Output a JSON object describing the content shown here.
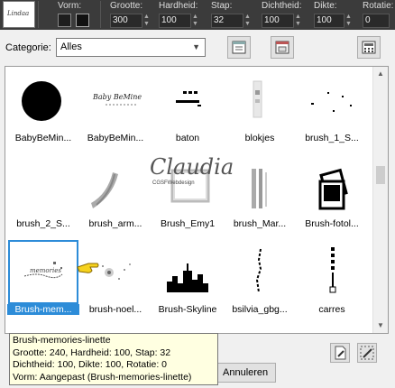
{
  "toolbar": {
    "thumb_text": "Lindaa",
    "shape_label": "Vorm:",
    "fields": [
      {
        "label": "Grootte:",
        "value": "300"
      },
      {
        "label": "Hardheid:",
        "value": "100"
      },
      {
        "label": "Stap:",
        "value": "32"
      },
      {
        "label": "Dichtheid:",
        "value": "100"
      },
      {
        "label": "Dikte:",
        "value": "100"
      },
      {
        "label": "Rotatie:",
        "value": "0"
      }
    ]
  },
  "category": {
    "label": "Categorie:",
    "value": "Alles"
  },
  "brushes": [
    {
      "name": "BabyBeMin..."
    },
    {
      "name": "BabyBeMin..."
    },
    {
      "name": "baton"
    },
    {
      "name": "blokjes"
    },
    {
      "name": "brush_1_S..."
    },
    {
      "name": "brush_2_S..."
    },
    {
      "name": "brush_arm..."
    },
    {
      "name": "Brush_Emy1"
    },
    {
      "name": "brush_Mar..."
    },
    {
      "name": "Brush-fotol..."
    },
    {
      "name": "Brush-mem..."
    },
    {
      "name": "brush-noel..."
    },
    {
      "name": "Brush-Skyline"
    },
    {
      "name": "bsilvia_gbg..."
    },
    {
      "name": "carres"
    }
  ],
  "watermark": {
    "line1": "Claudia",
    "line2": "CGSFWebdesign"
  },
  "tooltip": {
    "line1": "Brush-memories-linette",
    "line2": "Grootte: 240, Hardheid: 100, Stap: 32",
    "line3": "Dichtheid: 100, Dikte: 100, Rotatie: 0",
    "line4": "Vorm: Aangepast (Brush-memories-linette)"
  },
  "buttons": {
    "cancel": "Annuleren"
  }
}
